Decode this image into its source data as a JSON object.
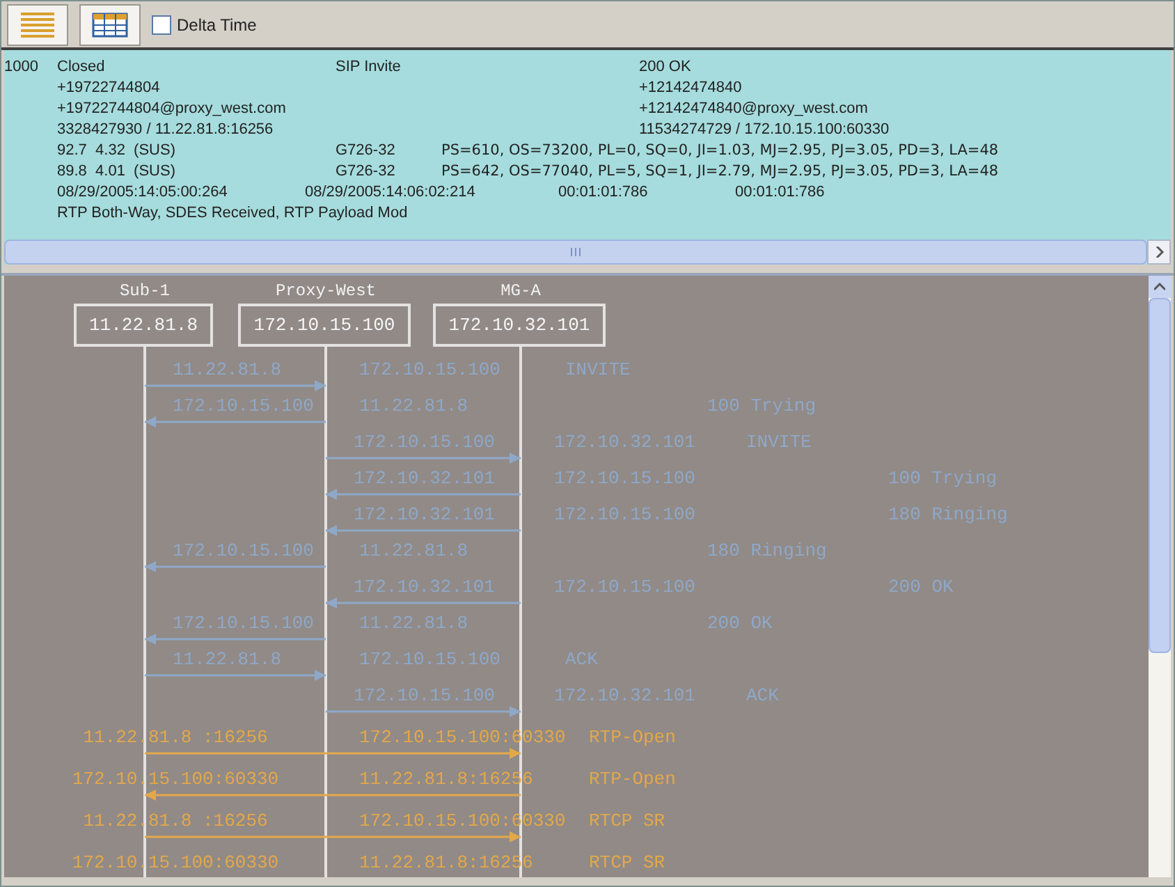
{
  "toolbar": {
    "view_buttons": [
      {
        "kind": "list"
      },
      {
        "kind": "table"
      }
    ],
    "delta_time": {
      "label": "Delta Time",
      "checked": false
    }
  },
  "summary": {
    "id": "1000",
    "status": "Closed",
    "method": "SIP Invite",
    "response": "200 OK",
    "caller_number": "+19722744804",
    "callee_number": "+12142474840",
    "caller_uri": "+19722744804@proxy_west.com",
    "callee_uri": "+12142474840@proxy_west.com",
    "caller_media": "3328427930 / 11.22.81.8:16256",
    "callee_media": "11534274729 / 172.10.15.100:60330",
    "streams": [
      {
        "quality": "92.7  4.32  (SUS)",
        "codec": "G726-32",
        "stats": "PS=610, OS=73200, PL=0, SQ=0, JI=1.03, MJ=2.95, PJ=3.05, PD=3, LA=48"
      },
      {
        "quality": "89.8  4.01  (SUS)",
        "codec": "G726-32",
        "stats": "PS=642, OS=77040, PL=5, SQ=1, JI=2.79, MJ=2.95, PJ=3.05, PD=3, LA=48"
      }
    ],
    "start_time": "08/29/2005:14:05:00:264",
    "end_time": "08/29/2005:14:06:02:214",
    "duration": "00:01:01:786",
    "media_duration": "00:01:01:786",
    "flags": "RTP Both-Way, SDES Received, RTP Payload Mod"
  },
  "diagram": {
    "nodes": [
      {
        "name": "Sub-1",
        "address": "11.22.81.8"
      },
      {
        "name": "Proxy-West",
        "address": "172.10.15.100"
      },
      {
        "name": "MG-A",
        "address": "172.10.32.101"
      }
    ],
    "messages": [
      {
        "kind": "access",
        "reverse": false,
        "source": "11.22.81.8",
        "destination": "172.10.15.100",
        "label": "INVITE"
      },
      {
        "kind": "access",
        "reverse": true,
        "source": "172.10.15.100",
        "destination": "11.22.81.8",
        "label": "100 Trying"
      },
      {
        "kind": "trunk",
        "reverse": false,
        "source": "172.10.15.100",
        "destination": "172.10.32.101",
        "label": "INVITE"
      },
      {
        "kind": "trunk",
        "reverse": true,
        "source": "172.10.32.101",
        "destination": "172.10.15.100",
        "label": "100 Trying"
      },
      {
        "kind": "trunk",
        "reverse": true,
        "source": "172.10.32.101",
        "destination": "172.10.15.100",
        "label": "180 Ringing"
      },
      {
        "kind": "access",
        "reverse": true,
        "source": "172.10.15.100",
        "destination": "11.22.81.8",
        "label": "180 Ringing"
      },
      {
        "kind": "trunk",
        "reverse": true,
        "source": "172.10.32.101",
        "destination": "172.10.15.100",
        "label": "200 OK"
      },
      {
        "kind": "access",
        "reverse": true,
        "source": "172.10.15.100",
        "destination": "11.22.81.8",
        "label": "200 OK"
      },
      {
        "kind": "access",
        "reverse": false,
        "source": "11.22.81.8",
        "destination": "172.10.15.100",
        "label": "ACK"
      },
      {
        "kind": "trunk",
        "reverse": false,
        "source": "172.10.15.100",
        "destination": "172.10.32.101",
        "label": "ACK"
      },
      {
        "kind": "media",
        "reverse": false,
        "source": "11.22.81.8 :16256",
        "destination": "172.10.15.100:60330",
        "label": "RTP-Open"
      },
      {
        "kind": "media",
        "reverse": true,
        "source": "172.10.15.100:60330",
        "destination": "11.22.81.8:16256",
        "label": "RTP-Open"
      },
      {
        "kind": "media",
        "reverse": false,
        "source": "11.22.81.8 :16256",
        "destination": "172.10.15.100:60330",
        "label": "RTCP SR"
      },
      {
        "kind": "media",
        "source": "172.10.15.100:60330",
        "destination": "11.22.81.8:16256",
        "label": "RTCP SR"
      }
    ]
  }
}
